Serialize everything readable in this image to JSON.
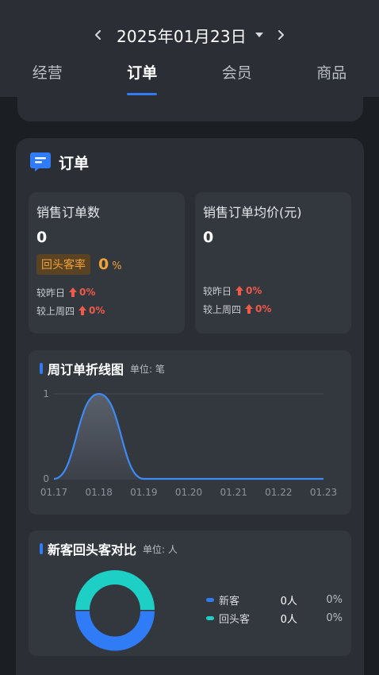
{
  "header": {
    "date": "2025年01月23日",
    "tabs": [
      {
        "label": "经营",
        "active": false
      },
      {
        "label": "订单",
        "active": true
      },
      {
        "label": "会员",
        "active": false
      },
      {
        "label": "商品",
        "active": false
      }
    ]
  },
  "colors": {
    "accent": "#2f7cf6",
    "teal": "#1ecfc6",
    "orange": "#f0a338",
    "red": "#ef5a4b"
  },
  "order_card": {
    "icon": "order-list-icon",
    "title": "订单",
    "sales_count": {
      "label": "销售订单数",
      "value": "0",
      "repeat_rate_label": "回头客率",
      "repeat_rate_value": "0",
      "repeat_rate_unit": "%",
      "vs_yesterday_label": "较昨日",
      "vs_yesterday_value": "0%",
      "vs_last_week_label": "较上周四",
      "vs_last_week_value": "0%"
    },
    "avg_price": {
      "label": "销售订单均价(元)",
      "value": "0",
      "vs_yesterday_label": "较昨日",
      "vs_yesterday_value": "0%",
      "vs_last_week_label": "较上周四",
      "vs_last_week_value": "0%"
    }
  },
  "weekly_chart": {
    "title": "周订单折线图",
    "unit": "单位: 笔"
  },
  "customer_ratio": {
    "title": "新客回头客对比",
    "unit": "单位: 人",
    "legend": [
      {
        "name": "新客",
        "count": "0人",
        "percent": "0%",
        "color": "#2f7cf6"
      },
      {
        "name": "回头客",
        "count": "0人",
        "percent": "0%",
        "color": "#1ecfc6"
      }
    ]
  },
  "chart_data": [
    {
      "type": "line",
      "title": "周订单折线图",
      "ylabel": "单位: 笔",
      "categories": [
        "01.17",
        "01.18",
        "01.19",
        "01.20",
        "01.21",
        "01.22",
        "01.23"
      ],
      "values": [
        0,
        1,
        0,
        0,
        0,
        0,
        0
      ],
      "ylim": [
        0,
        1
      ],
      "yticks": [
        "0",
        "1"
      ],
      "grid": true,
      "smooth": true
    },
    {
      "type": "pie",
      "title": "新客回头客对比",
      "categories": [
        "新客",
        "回头客"
      ],
      "values": [
        0,
        0
      ],
      "donut": true
    }
  ]
}
